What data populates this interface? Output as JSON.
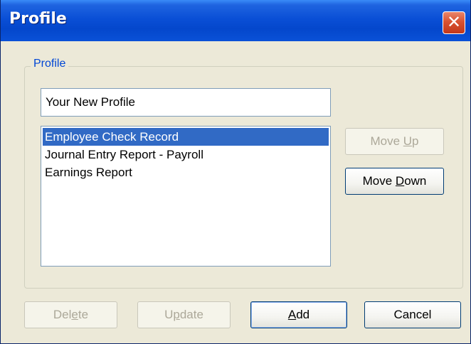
{
  "window": {
    "title": "Profile",
    "close_label": "✕"
  },
  "group": {
    "legend": "Profile"
  },
  "name_field": {
    "value": "Your New Profile"
  },
  "list": {
    "items": [
      {
        "label": "Employee Check Record",
        "selected": true
      },
      {
        "label": "Journal Entry Report - Payroll",
        "selected": false
      },
      {
        "label": "Earnings Report",
        "selected": false
      }
    ]
  },
  "buttons": {
    "move_up": {
      "pre": "Move ",
      "accel": "U",
      "post": "p",
      "enabled": false
    },
    "move_down": {
      "pre": "Move ",
      "accel": "D",
      "post": "own",
      "enabled": true
    },
    "delete": {
      "pre": "Del",
      "accel": "e",
      "post": "te",
      "enabled": false
    },
    "update": {
      "pre": "U",
      "accel": "p",
      "post": "date",
      "enabled": false
    },
    "add": {
      "pre": "",
      "accel": "A",
      "post": "dd",
      "enabled": true
    },
    "cancel": {
      "pre": "Cancel",
      "accel": "",
      "post": "",
      "enabled": true
    }
  }
}
